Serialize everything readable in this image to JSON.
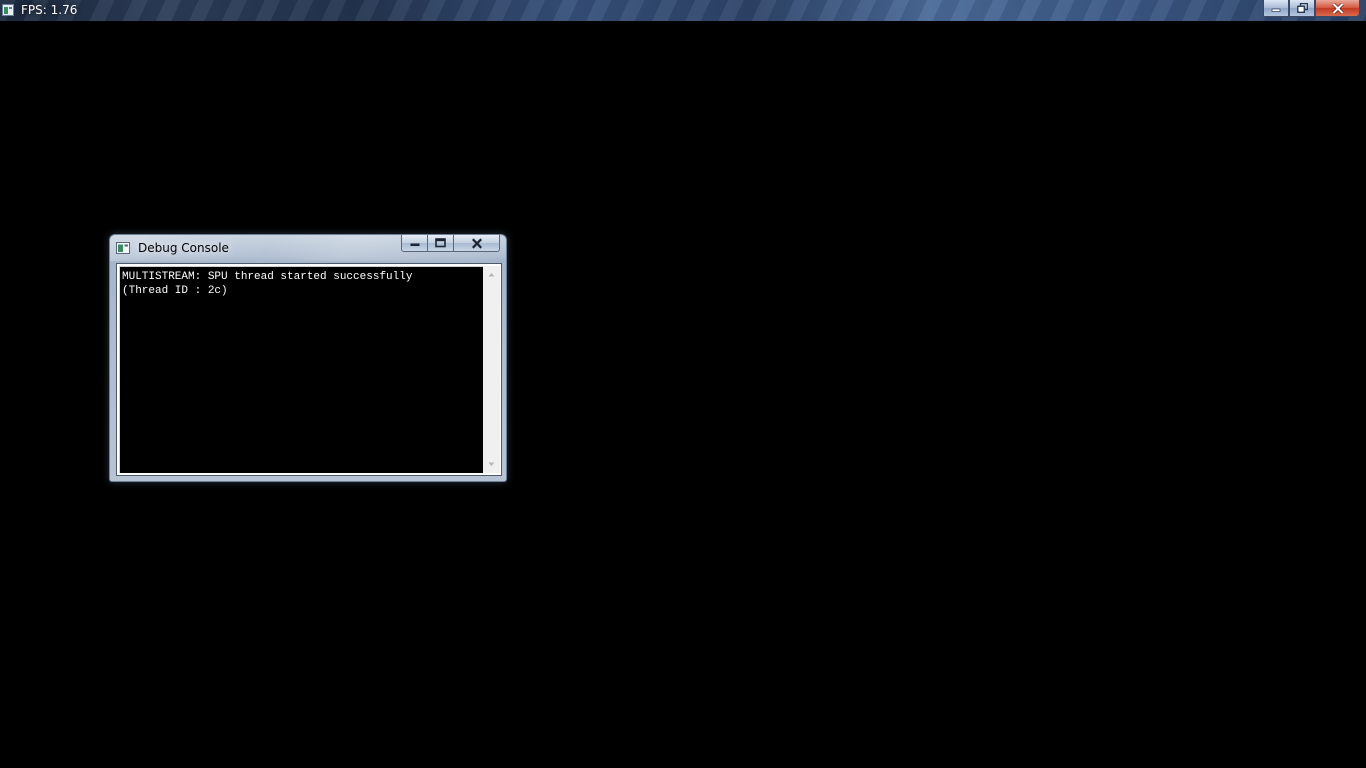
{
  "main_window": {
    "title": "FPS: 1.76",
    "icon": "app-window-icon",
    "controls": {
      "minimize_icon": "minimize-icon",
      "restore_icon": "restore-icon",
      "close_icon": "close-icon"
    }
  },
  "debug_console": {
    "title": "Debug Console",
    "icon": "console-window-icon",
    "lines": [
      "MULTISTREAM: SPU thread started successfully",
      "(Thread ID : 2c)"
    ],
    "controls": {
      "minimize_icon": "minimize-icon",
      "maximize_icon": "maximize-icon",
      "close_icon": "close-icon"
    },
    "scrollbar": {
      "up_icon": "scroll-up-arrow-icon",
      "down_icon": "scroll-down-arrow-icon"
    }
  },
  "colors": {
    "background": "#000000",
    "console_text": "#ffffff",
    "close_button": "#c03a22"
  }
}
